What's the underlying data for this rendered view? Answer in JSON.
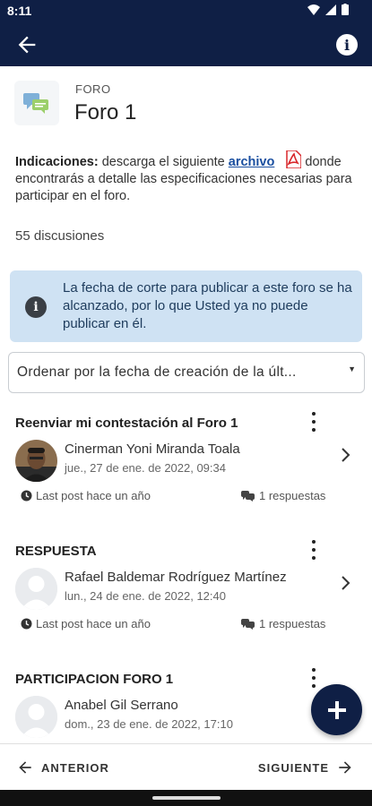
{
  "status_bar": {
    "time": "8:11"
  },
  "appbar": {
    "back_icon": "arrow-left-icon",
    "info_icon": "info-icon"
  },
  "forum": {
    "type": "FORO",
    "title": "Foro 1",
    "icon": "chat-bubbles-icon"
  },
  "instructions": {
    "label": "Indicaciones:",
    "text_before": " descarga el siguiente ",
    "link": "archivo",
    "text_after": " donde encontrarás a detalle las especificaciones necesarias para participar en el foro.",
    "file_icon": "pdf-icon"
  },
  "discussion_count": "55 discusiones",
  "alert": {
    "text": "La fecha de corte para publicar a este foro se ha alcanzado, por lo que Usted ya no puede publicar en él."
  },
  "sort": {
    "selected": "Ordenar por la fecha de creación de la últ..."
  },
  "discussions": [
    {
      "title": "Reenviar mi contestación al Foro 1",
      "author": "Cinerman Yoni Miranda Toala",
      "date": "jue., 27 de ene. de 2022, 09:34",
      "last_post": "Last post hace un año",
      "replies": "1 respuestas",
      "avatar": "photo"
    },
    {
      "title": "RESPUESTA",
      "author": "Rafael Baldemar Rodríguez Martínez",
      "date": "lun., 24 de ene. de 2022, 12:40",
      "last_post": "Last post hace un año",
      "replies": "1 respuestas",
      "avatar": "default"
    },
    {
      "title": "PARTICIPACION FORO 1",
      "author": "Anabel Gil Serrano",
      "date": "dom., 23 de ene. de 2022, 17:10",
      "avatar": "default"
    }
  ],
  "bottom_nav": {
    "prev": "ANTERIOR",
    "next": "SIGUIENTE"
  },
  "colors": {
    "primary": "#0f1f45",
    "alert_bg": "#cfe2f3",
    "link": "#1a4fa0"
  }
}
